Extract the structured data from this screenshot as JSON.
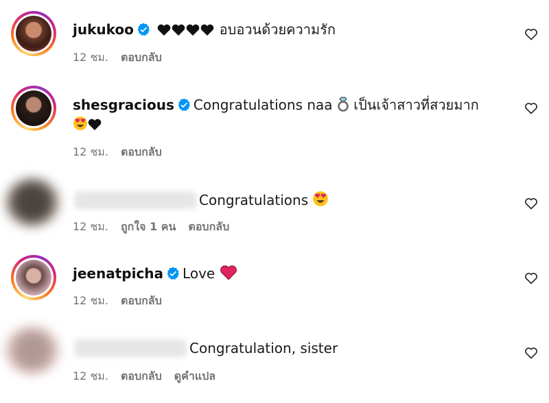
{
  "comments": [
    {
      "username": "jukukoo",
      "verified": true,
      "text": "อบอวนด้วยความรัก",
      "emojis": [
        "black-heart",
        "black-heart",
        "black-heart",
        "black-heart"
      ],
      "time": "12 ชม.",
      "reply_label": "ตอบกลับ"
    },
    {
      "username": "shesgracious",
      "verified": true,
      "text": "Congratulations naa",
      "text_after": "เป็นเจ้าสาวที่สวยมาก",
      "emojis": [
        "ring",
        "heart-eyes",
        "black-heart"
      ],
      "time": "12 ชม.",
      "reply_label": "ตอบกลับ"
    },
    {
      "username_hidden": true,
      "text": "Congratulations",
      "emojis": [
        "heart-eyes"
      ],
      "time": "12 ชม.",
      "likes_label": "ถูกใจ 1 คน",
      "reply_label": "ตอบกลับ"
    },
    {
      "username": "jeenatpicha",
      "verified": true,
      "text": "Love",
      "emojis": [
        "red-heart"
      ],
      "time": "12 ชม.",
      "reply_label": "ตอบกลับ"
    },
    {
      "username_hidden": true,
      "text": "Congratulation, sister",
      "time": "12 ชม.",
      "reply_label": "ตอบกลับ",
      "translate_label": "ดูคำแปล"
    }
  ],
  "colors": {
    "verified_blue": "#0095f6",
    "meta_gray": "#737373",
    "red_heart": "#e0245e"
  }
}
